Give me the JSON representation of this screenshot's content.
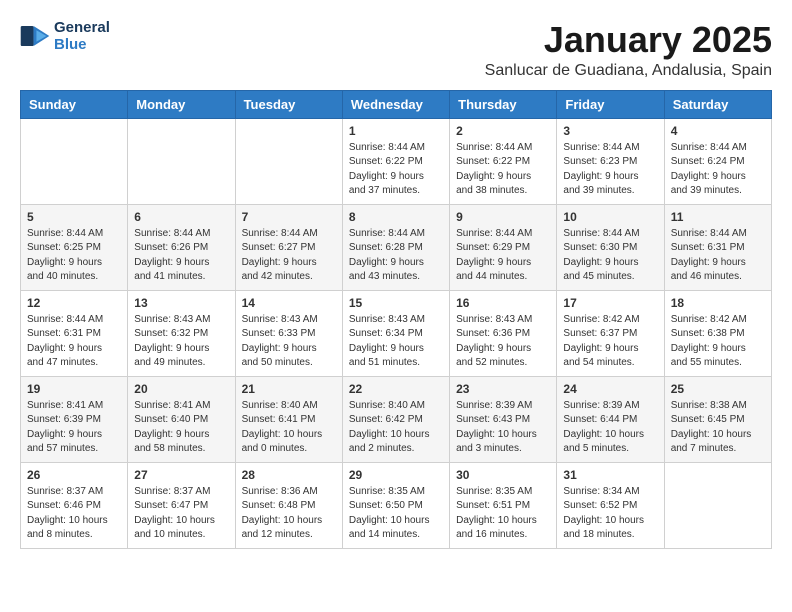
{
  "header": {
    "logo_line1": "General",
    "logo_line2": "Blue",
    "title": "January 2025",
    "subtitle": "Sanlucar de Guadiana, Andalusia, Spain"
  },
  "days_of_week": [
    "Sunday",
    "Monday",
    "Tuesday",
    "Wednesday",
    "Thursday",
    "Friday",
    "Saturday"
  ],
  "weeks": [
    [
      {
        "day": "",
        "info": ""
      },
      {
        "day": "",
        "info": ""
      },
      {
        "day": "",
        "info": ""
      },
      {
        "day": "1",
        "info": "Sunrise: 8:44 AM\nSunset: 6:22 PM\nDaylight: 9 hours\nand 37 minutes."
      },
      {
        "day": "2",
        "info": "Sunrise: 8:44 AM\nSunset: 6:22 PM\nDaylight: 9 hours\nand 38 minutes."
      },
      {
        "day": "3",
        "info": "Sunrise: 8:44 AM\nSunset: 6:23 PM\nDaylight: 9 hours\nand 39 minutes."
      },
      {
        "day": "4",
        "info": "Sunrise: 8:44 AM\nSunset: 6:24 PM\nDaylight: 9 hours\nand 39 minutes."
      }
    ],
    [
      {
        "day": "5",
        "info": "Sunrise: 8:44 AM\nSunset: 6:25 PM\nDaylight: 9 hours\nand 40 minutes."
      },
      {
        "day": "6",
        "info": "Sunrise: 8:44 AM\nSunset: 6:26 PM\nDaylight: 9 hours\nand 41 minutes."
      },
      {
        "day": "7",
        "info": "Sunrise: 8:44 AM\nSunset: 6:27 PM\nDaylight: 9 hours\nand 42 minutes."
      },
      {
        "day": "8",
        "info": "Sunrise: 8:44 AM\nSunset: 6:28 PM\nDaylight: 9 hours\nand 43 minutes."
      },
      {
        "day": "9",
        "info": "Sunrise: 8:44 AM\nSunset: 6:29 PM\nDaylight: 9 hours\nand 44 minutes."
      },
      {
        "day": "10",
        "info": "Sunrise: 8:44 AM\nSunset: 6:30 PM\nDaylight: 9 hours\nand 45 minutes."
      },
      {
        "day": "11",
        "info": "Sunrise: 8:44 AM\nSunset: 6:31 PM\nDaylight: 9 hours\nand 46 minutes."
      }
    ],
    [
      {
        "day": "12",
        "info": "Sunrise: 8:44 AM\nSunset: 6:31 PM\nDaylight: 9 hours\nand 47 minutes."
      },
      {
        "day": "13",
        "info": "Sunrise: 8:43 AM\nSunset: 6:32 PM\nDaylight: 9 hours\nand 49 minutes."
      },
      {
        "day": "14",
        "info": "Sunrise: 8:43 AM\nSunset: 6:33 PM\nDaylight: 9 hours\nand 50 minutes."
      },
      {
        "day": "15",
        "info": "Sunrise: 8:43 AM\nSunset: 6:34 PM\nDaylight: 9 hours\nand 51 minutes."
      },
      {
        "day": "16",
        "info": "Sunrise: 8:43 AM\nSunset: 6:36 PM\nDaylight: 9 hours\nand 52 minutes."
      },
      {
        "day": "17",
        "info": "Sunrise: 8:42 AM\nSunset: 6:37 PM\nDaylight: 9 hours\nand 54 minutes."
      },
      {
        "day": "18",
        "info": "Sunrise: 8:42 AM\nSunset: 6:38 PM\nDaylight: 9 hours\nand 55 minutes."
      }
    ],
    [
      {
        "day": "19",
        "info": "Sunrise: 8:41 AM\nSunset: 6:39 PM\nDaylight: 9 hours\nand 57 minutes."
      },
      {
        "day": "20",
        "info": "Sunrise: 8:41 AM\nSunset: 6:40 PM\nDaylight: 9 hours\nand 58 minutes."
      },
      {
        "day": "21",
        "info": "Sunrise: 8:40 AM\nSunset: 6:41 PM\nDaylight: 10 hours\nand 0 minutes."
      },
      {
        "day": "22",
        "info": "Sunrise: 8:40 AM\nSunset: 6:42 PM\nDaylight: 10 hours\nand 2 minutes."
      },
      {
        "day": "23",
        "info": "Sunrise: 8:39 AM\nSunset: 6:43 PM\nDaylight: 10 hours\nand 3 minutes."
      },
      {
        "day": "24",
        "info": "Sunrise: 8:39 AM\nSunset: 6:44 PM\nDaylight: 10 hours\nand 5 minutes."
      },
      {
        "day": "25",
        "info": "Sunrise: 8:38 AM\nSunset: 6:45 PM\nDaylight: 10 hours\nand 7 minutes."
      }
    ],
    [
      {
        "day": "26",
        "info": "Sunrise: 8:37 AM\nSunset: 6:46 PM\nDaylight: 10 hours\nand 8 minutes."
      },
      {
        "day": "27",
        "info": "Sunrise: 8:37 AM\nSunset: 6:47 PM\nDaylight: 10 hours\nand 10 minutes."
      },
      {
        "day": "28",
        "info": "Sunrise: 8:36 AM\nSunset: 6:48 PM\nDaylight: 10 hours\nand 12 minutes."
      },
      {
        "day": "29",
        "info": "Sunrise: 8:35 AM\nSunset: 6:50 PM\nDaylight: 10 hours\nand 14 minutes."
      },
      {
        "day": "30",
        "info": "Sunrise: 8:35 AM\nSunset: 6:51 PM\nDaylight: 10 hours\nand 16 minutes."
      },
      {
        "day": "31",
        "info": "Sunrise: 8:34 AM\nSunset: 6:52 PM\nDaylight: 10 hours\nand 18 minutes."
      },
      {
        "day": "",
        "info": ""
      }
    ]
  ]
}
